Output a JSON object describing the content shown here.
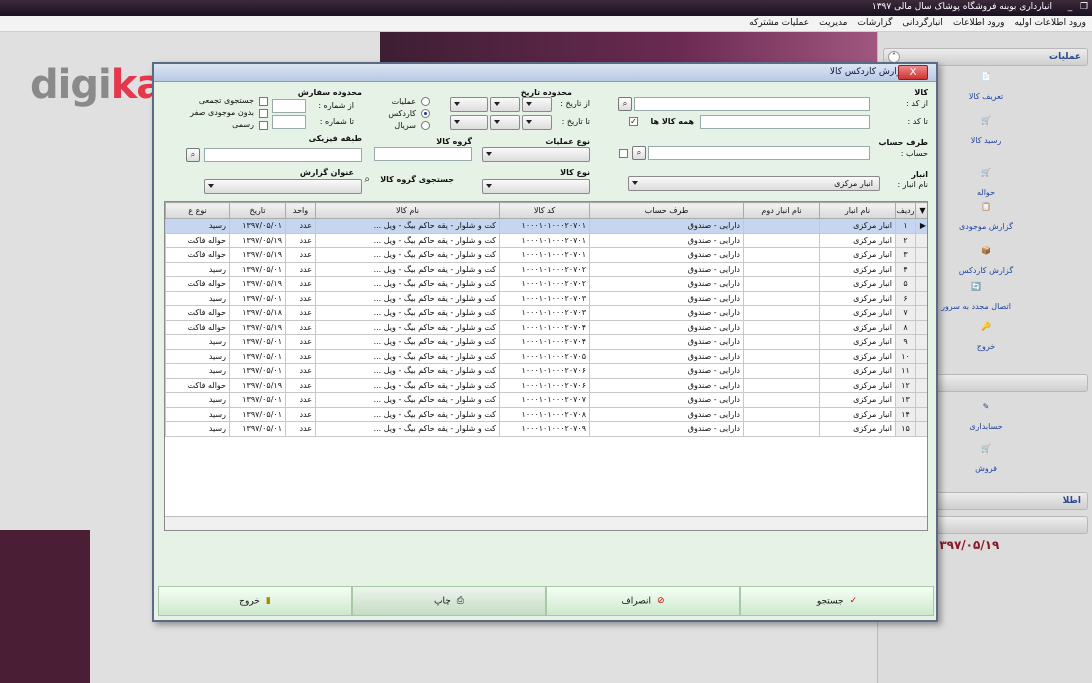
{
  "app": {
    "title": "انبارداری بوبنه فروشگاه پوشاک سال مالی ۱۳۹۷",
    "menu": [
      "ورود اطلاعات اولیه",
      "ورود اطلاعات",
      "انبارگردانی",
      "گزارشات",
      "مدیریت",
      "عملیات مشترکه"
    ],
    "watermark": {
      "part1": "digi",
      "part2": "kala"
    }
  },
  "side_panel": {
    "header1": "عملیات",
    "items1": [
      "تعریف کالا",
      "رسید کالا",
      "حواله",
      "گزارش موجودی",
      "گزارش کاردکس",
      "اتصال مجدد به سرور",
      "خروج"
    ],
    "items2": [
      "حسابداری",
      "فروش"
    ],
    "header3": "اطلا",
    "date": "۱۳۹۷/۰۵/۱۹"
  },
  "dialog": {
    "title": "گزارش کاردکس کالا",
    "close": "X",
    "filters": {
      "kala_label": "کالا",
      "az_kod": "از کد :",
      "ta_kod": "تا کد :",
      "hame_kalaha": "همه کالا ها",
      "taraf_hesab_label": "طرف حساب",
      "hesab": "حساب :",
      "anbar_label": "انبار",
      "nam_anbar": "نام انبار :",
      "anbar_value": "انبار مرکزی",
      "mahdude_tarikh": "محدوده تاریخ",
      "az_tarikh": "از تاریخ :",
      "ta_tarikh": "تا تاریخ :",
      "noe_amaliat_label": "نوع عملیات",
      "noe_kala_label": "نوع کالا",
      "gorooh_kala_label": "گروه کالا",
      "jostejooye_gorooh": "جستجوی گروه کالا",
      "radio_amaliat": "عملیات",
      "radio_kardex": "کاردکس",
      "radio_sarial": "سریال",
      "mahdude_sefaresh": "محدوده سفارش",
      "az_shomare": "از شماره :",
      "ta_shomare": "تا شماره :",
      "tabaghe_feizikie": "طبقه فیزیکی",
      "onvan_gozaresh": "عنوان گزارش",
      "chk_tajmi": "جستجوی تجمعی",
      "chk_bedoone": "بدون موجودی صفر",
      "chk_rasmi": "رسمی"
    },
    "grid": {
      "columns": [
        "ردیف",
        "نام انبار",
        "نام انبار دوم",
        "طرف حساب",
        "کد کالا",
        "نام کالا",
        "واحد",
        "تاریخ",
        "نوع ع"
      ],
      "rows": [
        [
          "۱",
          "انبار مرکزی",
          "",
          "دارایی - صندوق",
          "۱۰۰۰۱۰۱۰۰۰۲۰۷۰۱",
          "کت و شلوار - یقه حاکم بیگ - ویل ...",
          "عدد",
          "۱۳۹۷/۰۵/۰۱",
          "رسید"
        ],
        [
          "۲",
          "انبار مرکزی",
          "",
          "دارایی - صندوق",
          "۱۰۰۰۱۰۱۰۰۰۲۰۷۰۱",
          "کت و شلوار - یقه حاکم بیگ - ویل ...",
          "عدد",
          "۱۳۹۷/۰۵/۱۹",
          "حواله فاکت"
        ],
        [
          "۳",
          "انبار مرکزی",
          "",
          "دارایی - صندوق",
          "۱۰۰۰۱۰۱۰۰۰۲۰۷۰۱",
          "کت و شلوار - یقه حاکم بیگ - ویل ...",
          "عدد",
          "۱۳۹۷/۰۵/۱۹",
          "حواله فاکت"
        ],
        [
          "۴",
          "انبار مرکزی",
          "",
          "دارایی - صندوق",
          "۱۰۰۰۱۰۱۰۰۰۲۰۷۰۲",
          "کت و شلوار - یقه حاکم بیگ - ویل ...",
          "عدد",
          "۱۳۹۷/۰۵/۰۱",
          "رسید"
        ],
        [
          "۵",
          "انبار مرکزی",
          "",
          "دارایی - صندوق",
          "۱۰۰۰۱۰۱۰۰۰۲۰۷۰۲",
          "کت و شلوار - یقه حاکم بیگ - ویل ...",
          "عدد",
          "۱۳۹۷/۰۵/۱۹",
          "حواله فاکت"
        ],
        [
          "۶",
          "انبار مرکزی",
          "",
          "دارایی - صندوق",
          "۱۰۰۰۱۰۱۰۰۰۲۰۷۰۳",
          "کت و شلوار - یقه حاکم بیگ - ویل ...",
          "عدد",
          "۱۳۹۷/۰۵/۰۱",
          "رسید"
        ],
        [
          "۷",
          "انبار مرکزی",
          "",
          "دارایی - صندوق",
          "۱۰۰۰۱۰۱۰۰۰۲۰۷۰۳",
          "کت و شلوار - یقه حاکم بیگ - ویل ...",
          "عدد",
          "۱۳۹۷/۰۵/۱۸",
          "حواله فاکت"
        ],
        [
          "۸",
          "انبار مرکزی",
          "",
          "دارایی - صندوق",
          "۱۰۰۰۱۰۱۰۰۰۲۰۷۰۴",
          "کت و شلوار - یقه حاکم بیگ - ویل ...",
          "عدد",
          "۱۳۹۷/۰۵/۱۹",
          "حواله فاکت"
        ],
        [
          "۹",
          "انبار مرکزی",
          "",
          "دارایی - صندوق",
          "۱۰۰۰۱۰۱۰۰۰۲۰۷۰۴",
          "کت و شلوار - یقه حاکم بیگ - ویل ...",
          "عدد",
          "۱۳۹۷/۰۵/۰۱",
          "رسید"
        ],
        [
          "۱۰",
          "انبار مرکزی",
          "",
          "دارایی - صندوق",
          "۱۰۰۰۱۰۱۰۰۰۲۰۷۰۵",
          "کت و شلوار - یقه حاکم بیگ - ویل ...",
          "عدد",
          "۱۳۹۷/۰۵/۰۱",
          "رسید"
        ],
        [
          "۱۱",
          "انبار مرکزی",
          "",
          "دارایی - صندوق",
          "۱۰۰۰۱۰۱۰۰۰۲۰۷۰۶",
          "کت و شلوار - یقه حاکم بیگ - ویل ...",
          "عدد",
          "۱۳۹۷/۰۵/۰۱",
          "رسید"
        ],
        [
          "۱۲",
          "انبار مرکزی",
          "",
          "دارایی - صندوق",
          "۱۰۰۰۱۰۱۰۰۰۲۰۷۰۶",
          "کت و شلوار - یقه حاکم بیگ - ویل ...",
          "عدد",
          "۱۳۹۷/۰۵/۱۹",
          "حواله فاکت"
        ],
        [
          "۱۳",
          "انبار مرکزی",
          "",
          "دارایی - صندوق",
          "۱۰۰۰۱۰۱۰۰۰۲۰۷۰۷",
          "کت و شلوار - یقه حاکم بیگ - ویل ...",
          "عدد",
          "۱۳۹۷/۰۵/۰۱",
          "رسید"
        ],
        [
          "۱۴",
          "انبار مرکزی",
          "",
          "دارایی - صندوق",
          "۱۰۰۰۱۰۱۰۰۰۲۰۷۰۸",
          "کت و شلوار - یقه حاکم بیگ - ویل ...",
          "عدد",
          "۱۳۹۷/۰۵/۰۱",
          "رسید"
        ],
        [
          "۱۵",
          "انبار مرکزی",
          "",
          "دارایی - صندوق",
          "۱۰۰۰۱۰۱۰۰۰۲۰۷۰۹",
          "کت و شلوار - یقه حاکم بیگ - ویل ...",
          "عدد",
          "۱۳۹۷/۰۵/۰۱",
          "رسید"
        ]
      ]
    },
    "buttons": {
      "search": "جستجو",
      "cancel": "انصراف",
      "print": "چاپ",
      "exit": "خروج"
    }
  },
  "colors": {
    "accent": "#2046a0",
    "selection": "#c6d6f0",
    "dialog_bg": "#e6f2e6",
    "brand_red": "#e5384d"
  }
}
